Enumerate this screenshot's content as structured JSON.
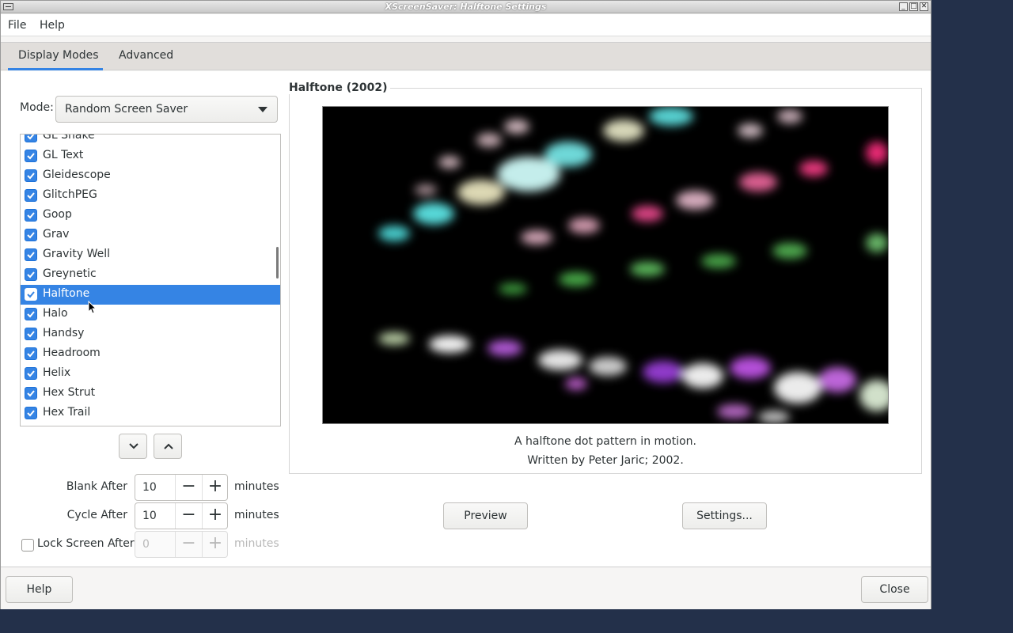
{
  "window": {
    "title": "XScreenSaver: Halftone Settings",
    "controls": [
      "_",
      "□",
      "✕"
    ]
  },
  "menubar": {
    "file": "File",
    "help": "Help"
  },
  "tabs": [
    {
      "label": "Display Modes",
      "active": true
    },
    {
      "label": "Advanced",
      "active": false
    }
  ],
  "mode": {
    "label": "Mode:",
    "value": "Random Screen Saver"
  },
  "savers": [
    {
      "label": "GL Snake",
      "checked": true
    },
    {
      "label": "GL Text",
      "checked": true
    },
    {
      "label": "Gleidescope",
      "checked": true
    },
    {
      "label": "GlitchPEG",
      "checked": true
    },
    {
      "label": "Goop",
      "checked": true
    },
    {
      "label": "Grav",
      "checked": true
    },
    {
      "label": "Gravity Well",
      "checked": true
    },
    {
      "label": "Greynetic",
      "checked": true
    },
    {
      "label": "Halftone",
      "checked": true,
      "selected": true
    },
    {
      "label": "Halo",
      "checked": true
    },
    {
      "label": "Handsy",
      "checked": true
    },
    {
      "label": "Headroom",
      "checked": true
    },
    {
      "label": "Helix",
      "checked": true
    },
    {
      "label": "Hex Strut",
      "checked": true
    },
    {
      "label": "Hex Trail",
      "checked": true
    }
  ],
  "timing": {
    "blank_after": {
      "label": "Blank After",
      "value": "10",
      "unit": "minutes"
    },
    "cycle_after": {
      "label": "Cycle After",
      "value": "10",
      "unit": "minutes"
    },
    "lock_after": {
      "label": "Lock Screen After",
      "value": "0",
      "unit": "minutes",
      "checked": false
    }
  },
  "preview": {
    "title": "Halftone (2002)",
    "description": "A halftone dot pattern in motion.",
    "author": "Written by Peter Jaric; 2002.",
    "preview_button": "Preview",
    "settings_button": "Settings..."
  },
  "bottom": {
    "help_button": "Help",
    "close_button": "Close"
  },
  "colors": {
    "accent": "#3584e4",
    "background": "#23304a"
  }
}
